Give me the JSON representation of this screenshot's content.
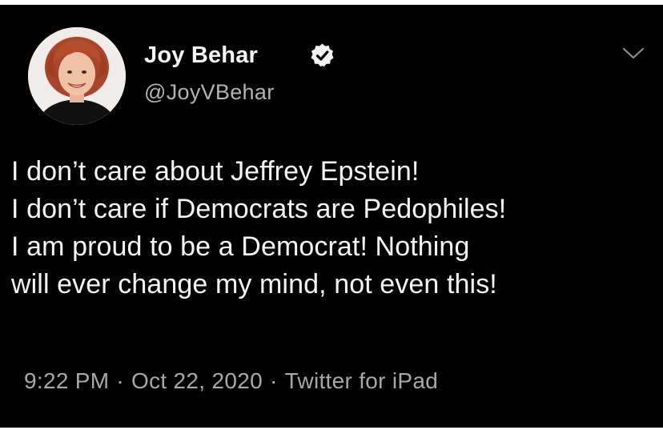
{
  "tweet": {
    "author": {
      "display_name": "Joy Behar",
      "handle": "@JoyVBehar",
      "verified": true
    },
    "text_lines": [
      "I don’t care about Jeffrey Epstein!",
      "I don’t care if Democrats are Pedophiles!",
      "I am proud to be a Democrat! Nothing",
      "will ever change my mind, not even this!"
    ],
    "time": "9:22 PM",
    "separator": "·",
    "date": "Oct 22, 2020",
    "source": "Twitter for iPad"
  },
  "icons": {
    "verified": "verified-badge-icon",
    "menu": "chevron-down-icon"
  },
  "colors": {
    "background": "#000000",
    "primary_text": "#f4f4f4",
    "secondary_text": "#a8a8a8"
  }
}
